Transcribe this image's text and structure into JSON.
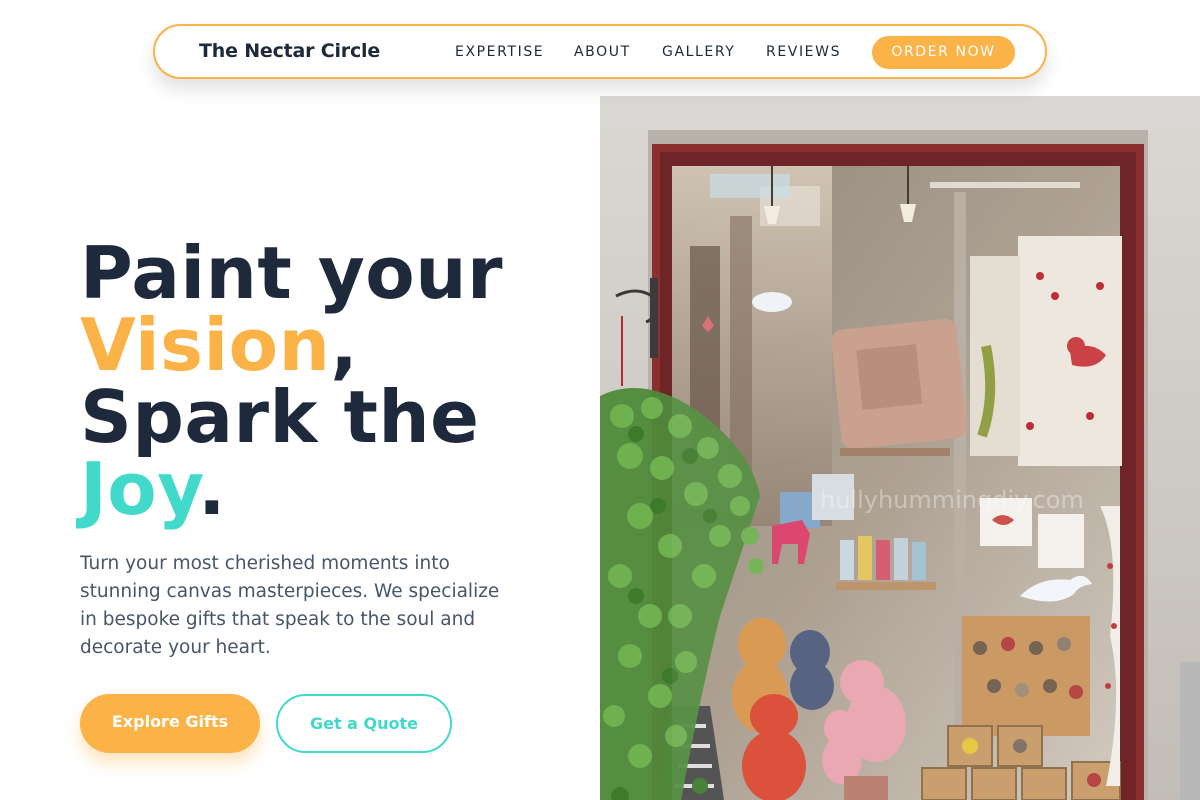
{
  "brand": {
    "name": "The Nectar Circle"
  },
  "nav": {
    "links": [
      "EXPERTISE",
      "ABOUT",
      "GALLERY",
      "REVIEWS"
    ],
    "cta": "ORDER NOW"
  },
  "hero": {
    "headline": {
      "part1": "Paint your",
      "highlight1": "Vision",
      "comma": ",",
      "part2": "Spark the",
      "highlight2": "Joy",
      "period": "."
    },
    "description": "Turn your most cherished moments into stunning canvas masterpieces. We specialize in bespoke gifts that speak to the soul and decorate your heart.",
    "primary_button": "Explore Gifts",
    "secondary_button": "Get a Quote",
    "image_watermark": "hullyhummingdiy.com"
  },
  "colors": {
    "accent_yellow": "#fbb247",
    "accent_teal": "#41d9c9",
    "text_dark": "#1e293b",
    "text_muted": "#475569"
  }
}
